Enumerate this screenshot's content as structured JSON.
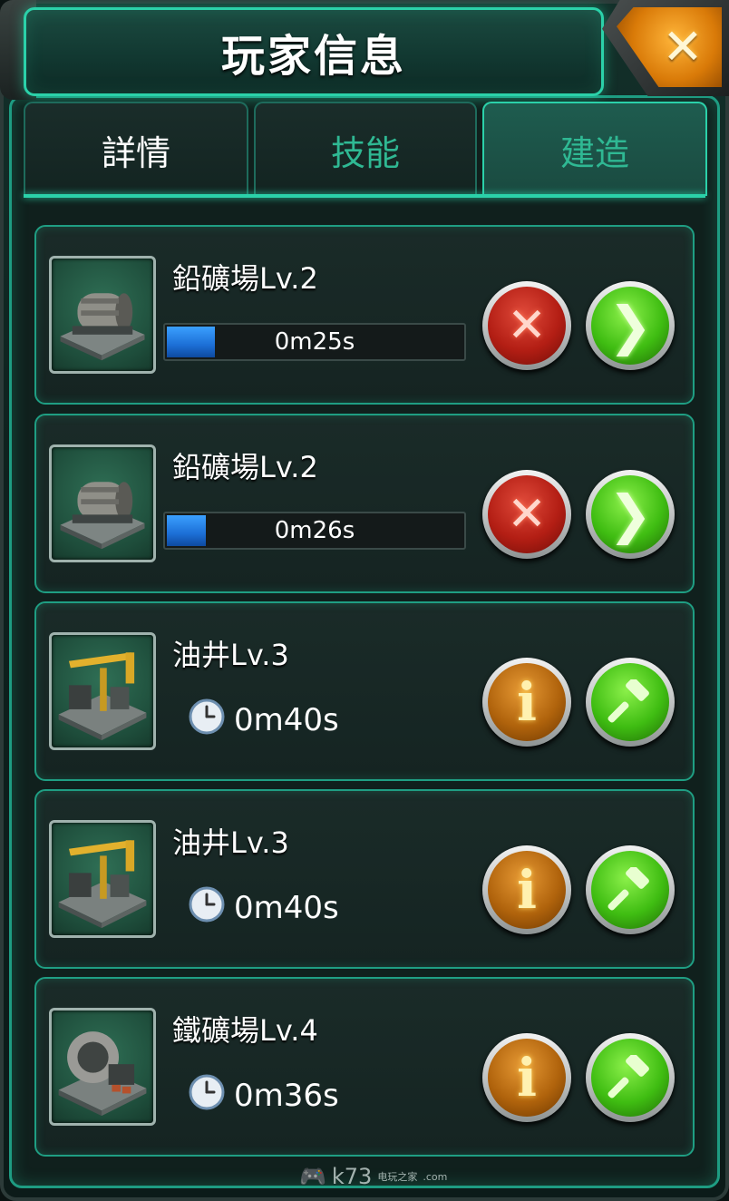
{
  "header": {
    "title": "玩家信息"
  },
  "close_button": {
    "icon": "close-icon",
    "label": "✕"
  },
  "tabs": [
    {
      "label": "詳情",
      "active": false
    },
    {
      "label": "技能",
      "active": false
    },
    {
      "label": "建造",
      "active": true
    }
  ],
  "rows": [
    {
      "title": "鉛礦場Lv.2",
      "mode": "progress",
      "progress": 0.16,
      "time": "0m25s",
      "left_button": "cancel",
      "right_button": "speedup",
      "thumb": "lead-mine"
    },
    {
      "title": "鉛礦場Lv.2",
      "mode": "progress",
      "progress": 0.13,
      "time": "0m26s",
      "left_button": "cancel",
      "right_button": "speedup",
      "thumb": "lead-mine"
    },
    {
      "title": "油井Lv.3",
      "mode": "timer",
      "time": "0m40s",
      "left_button": "info",
      "right_button": "build",
      "thumb": "oil-well"
    },
    {
      "title": "油井Lv.3",
      "mode": "timer",
      "time": "0m40s",
      "left_button": "info",
      "right_button": "build",
      "thumb": "oil-well"
    },
    {
      "title": "鐵礦場Lv.4",
      "mode": "timer",
      "time": "0m36s",
      "left_button": "info",
      "right_button": "build",
      "thumb": "iron-mine"
    }
  ],
  "watermark": {
    "main": "k73",
    "sub": "电玩之家",
    "domain": ".com"
  },
  "colors": {
    "accent": "#2bd1a9",
    "progress": "#1c6fd6",
    "close": "#d97a08"
  }
}
